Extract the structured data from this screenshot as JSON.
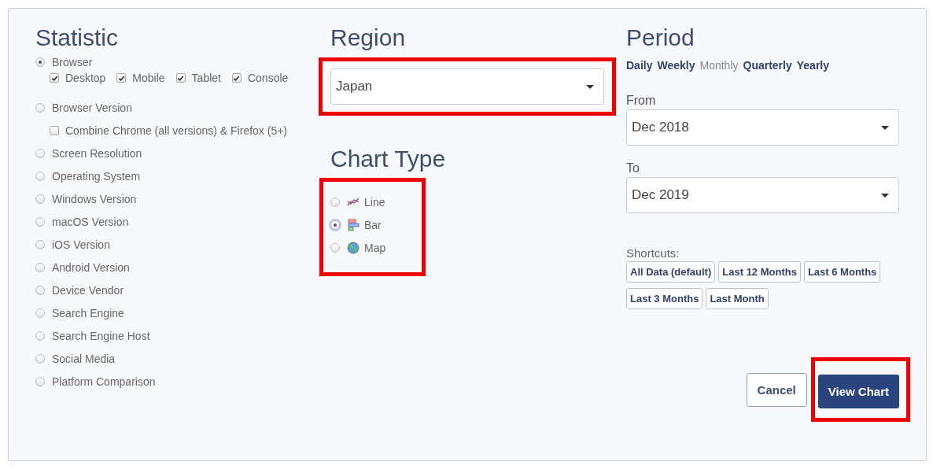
{
  "statistic": {
    "title": "Statistic",
    "items": [
      {
        "label": "Browser",
        "selected": true,
        "options": [
          {
            "label": "Desktop",
            "checked": true
          },
          {
            "label": "Mobile",
            "checked": true
          },
          {
            "label": "Tablet",
            "checked": true
          },
          {
            "label": "Console",
            "checked": true
          }
        ]
      },
      {
        "label": "Browser Version",
        "selected": false,
        "options": [
          {
            "label": "Combine Chrome (all versions) & Firefox (5+)",
            "checked": false
          }
        ]
      },
      {
        "label": "Screen Resolution",
        "selected": false
      },
      {
        "label": "Operating System",
        "selected": false
      },
      {
        "label": "Windows Version",
        "selected": false
      },
      {
        "label": "macOS Version",
        "selected": false
      },
      {
        "label": "iOS Version",
        "selected": false
      },
      {
        "label": "Android Version",
        "selected": false
      },
      {
        "label": "Device Vendor",
        "selected": false
      },
      {
        "label": "Search Engine",
        "selected": false
      },
      {
        "label": "Search Engine Host",
        "selected": false
      },
      {
        "label": "Social Media",
        "selected": false
      },
      {
        "label": "Platform Comparison",
        "selected": false
      }
    ]
  },
  "region": {
    "title": "Region",
    "value": "Japan"
  },
  "chart_type": {
    "title": "Chart Type",
    "items": [
      {
        "label": "Line",
        "kind": "line",
        "selected": false
      },
      {
        "label": "Bar",
        "kind": "bar",
        "selected": true
      },
      {
        "label": "Map",
        "kind": "map",
        "selected": false
      }
    ]
  },
  "period": {
    "title": "Period",
    "granularity": [
      {
        "label": "Daily",
        "selected": false
      },
      {
        "label": "Weekly",
        "selected": false
      },
      {
        "label": "Monthly",
        "selected": true
      },
      {
        "label": "Quarterly",
        "selected": false
      },
      {
        "label": "Yearly",
        "selected": false
      }
    ],
    "from": {
      "label": "From",
      "value": "Dec 2018"
    },
    "to": {
      "label": "To",
      "value": "Dec 2019"
    },
    "shortcuts_label": "Shortcuts:",
    "shortcuts": [
      "All Data (default)",
      "Last 12 Months",
      "Last 6 Months",
      "Last 3 Months",
      "Last Month"
    ]
  },
  "buttons": {
    "cancel": "Cancel",
    "submit": "View Chart"
  }
}
